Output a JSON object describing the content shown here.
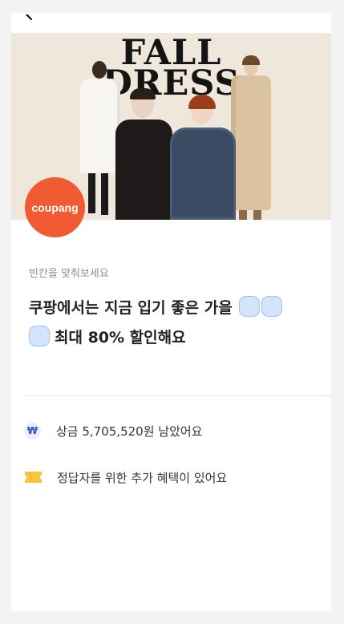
{
  "banner": {
    "title_line1": "FALL",
    "title_line2": "DRESS"
  },
  "logo": {
    "text": "coupang",
    "color": "#f15b33"
  },
  "quiz": {
    "prompt": "빈칸을 맞춰보세요",
    "question_line1": "쿠팡에서는 지금 입기 좋은 가을",
    "question_line2": "최대 80% 할인해요"
  },
  "info": {
    "prize_icon": "won-icon",
    "prize_text": "상금 5,705,520원 남았어요",
    "benefit_icon": "ticket-icon",
    "benefit_text": "정답자를 위한 추가 혜택이 있어요"
  }
}
